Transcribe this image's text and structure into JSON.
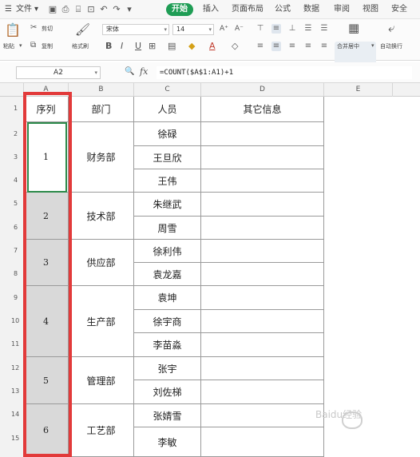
{
  "ribbon": {
    "menu": {
      "file": "文件",
      "tabs": [
        "开始",
        "插入",
        "页面布局",
        "公式",
        "数据",
        "审阅",
        "视图",
        "安全"
      ],
      "active_tab": "开始"
    },
    "toolbar": {
      "paste": "粘贴",
      "cut": "剪切",
      "copy": "复制",
      "format_painter": "格式刷",
      "font_name": "宋体",
      "font_size": "14",
      "font_grow": "A⁺",
      "font_shrink": "A⁻",
      "bold": "B",
      "italic": "I",
      "underline": "U",
      "merge_center": "合并居中",
      "wrap_text": "自动换行"
    }
  },
  "formula_bar": {
    "name_box": "A2",
    "fx": "fx",
    "formula": "=COUNT($A$1:A1)+1"
  },
  "sheet": {
    "columns": [
      "A",
      "B",
      "C",
      "D",
      "E"
    ],
    "rows": [
      "1",
      "2",
      "3",
      "4",
      "5",
      "6",
      "7",
      "8",
      "9",
      "10",
      "11",
      "12",
      "13",
      "14",
      "15"
    ],
    "headers": {
      "a": "序列",
      "b": "部门",
      "c": "人员",
      "d": "其它信息"
    },
    "groups": [
      {
        "seq": "1",
        "dept": "财务部"
      },
      {
        "seq": "2",
        "dept": "技术部"
      },
      {
        "seq": "3",
        "dept": "供应部"
      },
      {
        "seq": "4",
        "dept": "生产部"
      },
      {
        "seq": "5",
        "dept": "管理部"
      },
      {
        "seq": "6",
        "dept": "工艺部"
      }
    ],
    "people": [
      "徐碌",
      "王旦欣",
      "王伟",
      "朱继武",
      "周雪",
      "徐利伟",
      "袁龙嘉",
      "袁坤",
      "徐宇商",
      "李苗淼",
      "张宇",
      "刘佐梯",
      "张婧雪",
      "李敏"
    ]
  },
  "watermark": "Baidu经验",
  "colors": {
    "active_tab": "#1f9d55",
    "highlight_frame": "#e23a3a",
    "selection": "#2c8a4a",
    "merged_fill": "#d9d9d9"
  }
}
